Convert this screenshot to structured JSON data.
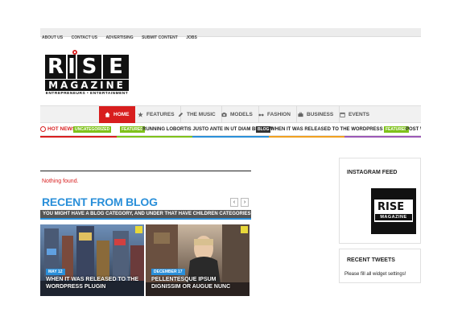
{
  "topbar": {
    "links": [
      "ABOUT US",
      "CONTACT US",
      "ADVERTISING",
      "SUBMIT CONTENT",
      "JOBS"
    ]
  },
  "logo": {
    "word": "RISE",
    "magazine": "MAGAZINE",
    "tagline": "ENTREPRENEURS • ENTERTAINMENT"
  },
  "nav": {
    "items": [
      {
        "label": "HOME",
        "icon": "home-icon"
      },
      {
        "label": "FEATURES",
        "icon": "star-icon"
      },
      {
        "label": "THE MUSIC",
        "icon": "pen-icon"
      },
      {
        "label": "MODELS",
        "icon": "camera-icon"
      },
      {
        "label": "FASHION",
        "icon": "glasses-icon"
      },
      {
        "label": "BUSINESS",
        "icon": "briefcase-icon"
      },
      {
        "label": "EVENTS",
        "icon": "calendar-icon"
      }
    ]
  },
  "ticker": {
    "hot_label": "HOT NEWS",
    "items": [
      {
        "badge": "UNCATEGORIZED",
        "text": ""
      },
      {
        "badge": "FEATURED",
        "text": "RUNNING LOBORTIS JUSTO ANTE IN UT DIAM BLANDIT"
      },
      {
        "badge": "BLOG",
        "text": "WHEN IT WAS RELEASED TO THE WORDPRESS PLUGIN"
      },
      {
        "badge": "FEATURED",
        "text": "POST WI"
      }
    ],
    "colors": [
      "#d81e1e",
      "#7fc21b",
      "#2a8fd9",
      "#f0a020",
      "#9b59b6"
    ]
  },
  "main": {
    "nothing_found": "Nothing found.",
    "recent_title": "RECENT FROM BLOG",
    "recent_subtitle": "YOU MIGHT HAVE A BLOG CATEGORY, AND UNDER THAT HAVE CHILDREN CATEGORIES",
    "prev_label": "‹",
    "next_label": "›",
    "cards": [
      {
        "date": "MAY 12",
        "title": "WHEN IT WAS RELEASED TO THE WORDPRESS PLUGIN"
      },
      {
        "date": "DECEMBER 17",
        "title": "PELLENTESQUE IPSUM DIGNISSIM OR AUGUE NUNC"
      }
    ]
  },
  "sidebar": {
    "instagram_title": "INSTAGRAM FEED",
    "instagram_logo_word": "RISE",
    "instagram_logo_mag": "MAGAZINE",
    "tweets_title": "RECENT TWEETS",
    "tweets_message": "Please fill all widget settings!"
  }
}
